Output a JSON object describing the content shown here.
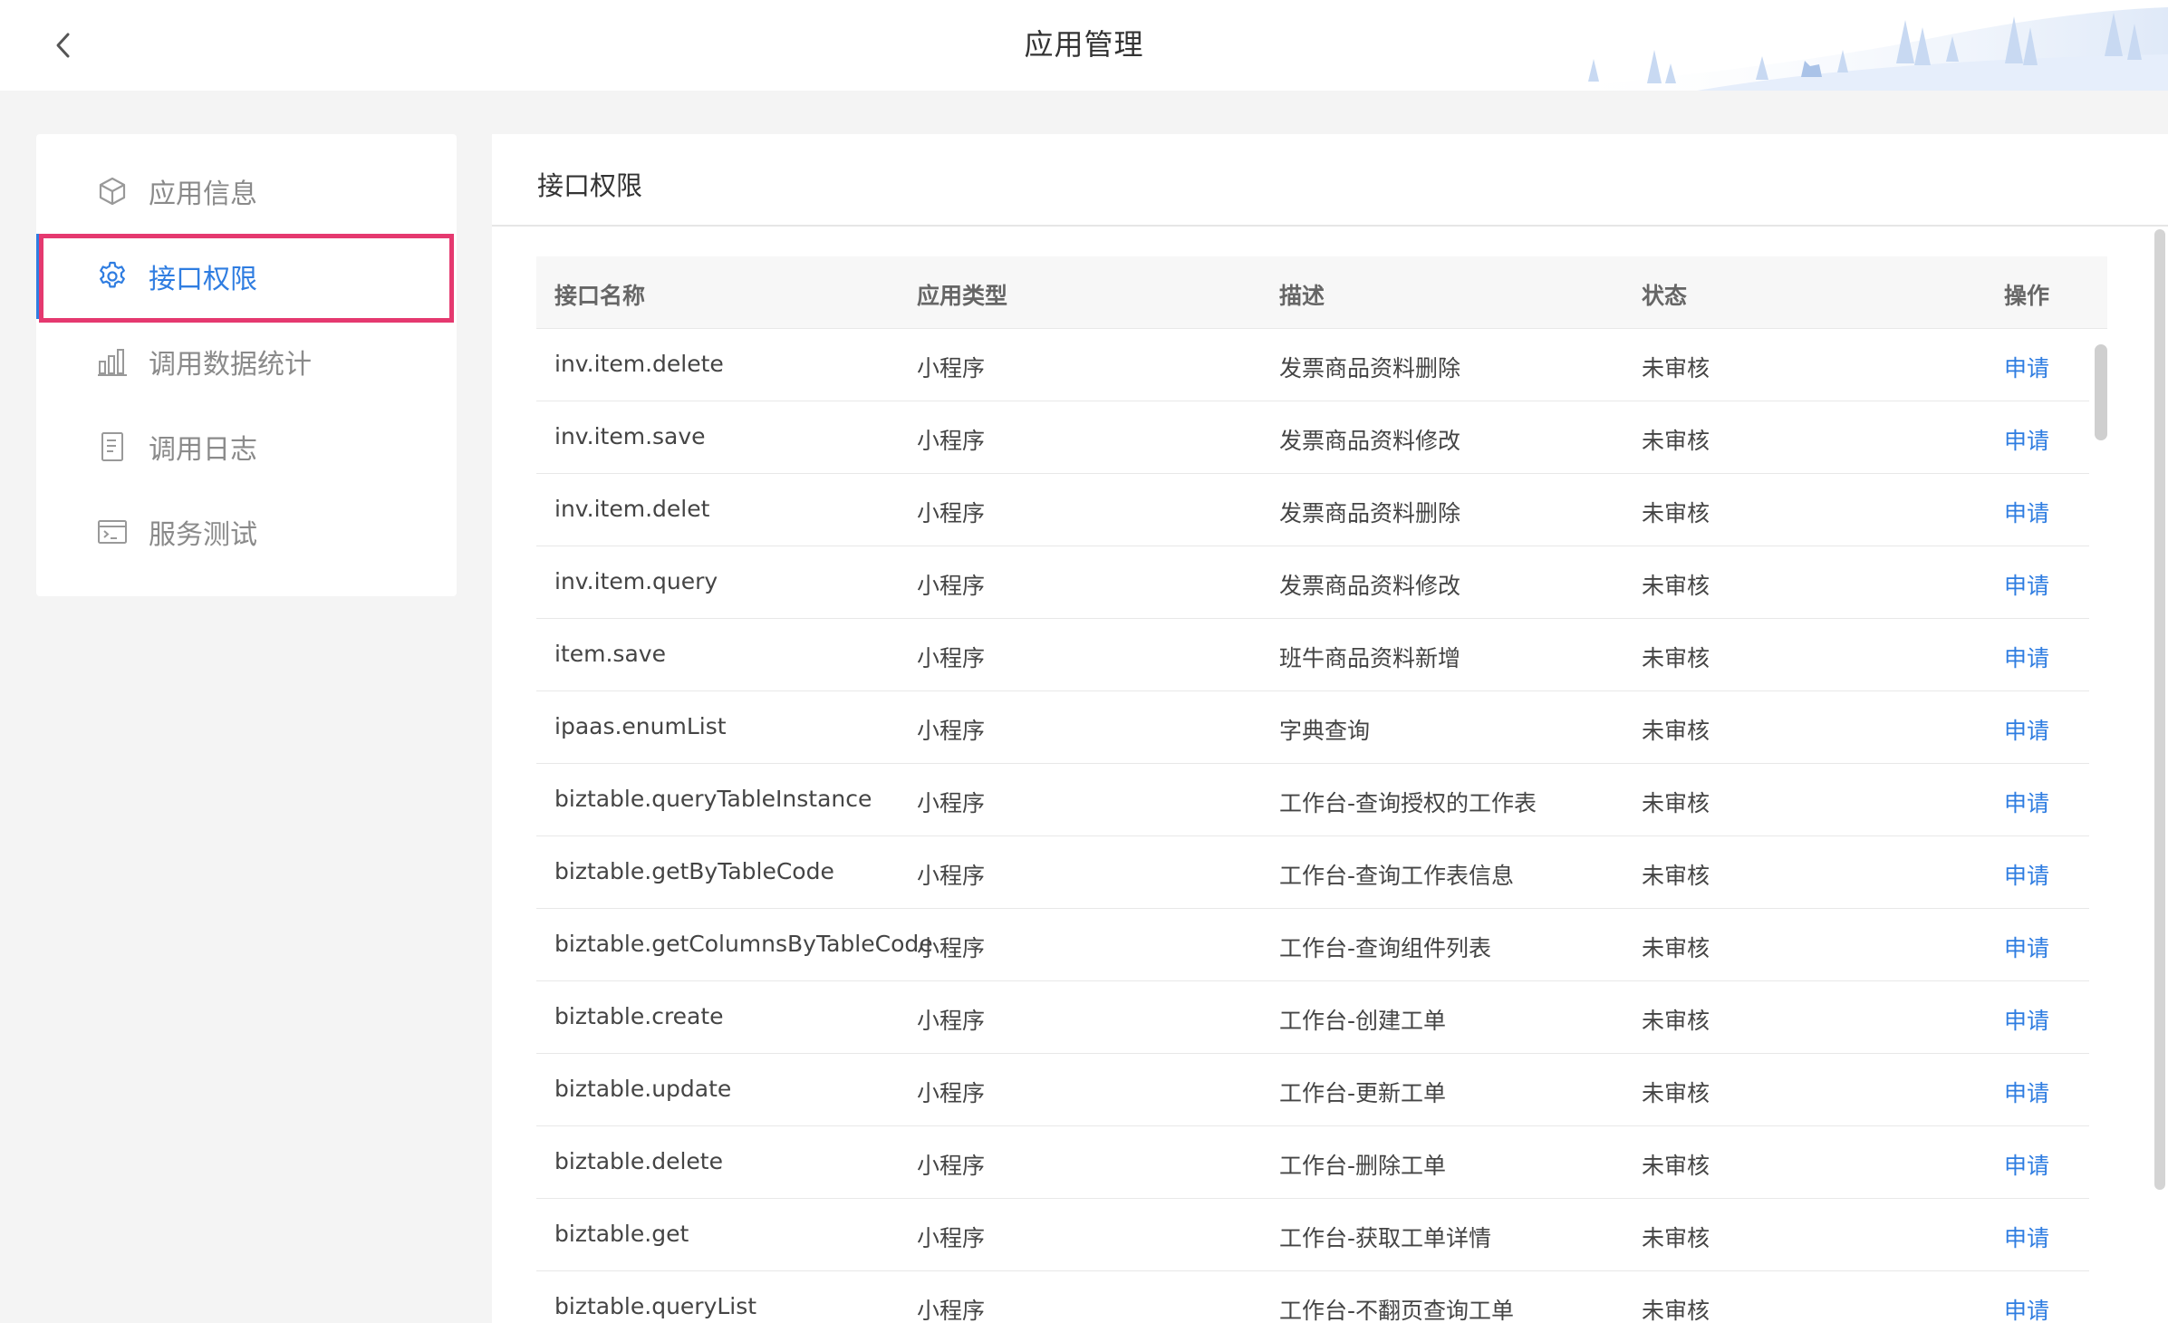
{
  "header": {
    "title": "应用管理",
    "back_icon": "chevron-left-icon"
  },
  "sidebar": {
    "items": [
      {
        "label": "应用信息",
        "icon": "cube-icon"
      },
      {
        "label": "接口权限",
        "icon": "gear-icon",
        "active": true
      },
      {
        "label": "调用数据统计",
        "icon": "bar-chart-icon"
      },
      {
        "label": "调用日志",
        "icon": "document-icon"
      },
      {
        "label": "服务测试",
        "icon": "terminal-icon"
      }
    ]
  },
  "main": {
    "title": "接口权限",
    "table": {
      "columns": [
        "接口名称",
        "应用类型",
        "描述",
        "状态",
        "操作"
      ],
      "rows": [
        {
          "name": "inv.item.delete",
          "type": "小程序",
          "desc": "发票商品资料删除",
          "status": "未审核",
          "action": "申请"
        },
        {
          "name": "inv.item.save",
          "type": "小程序",
          "desc": "发票商品资料修改",
          "status": "未审核",
          "action": "申请"
        },
        {
          "name": "inv.item.delet",
          "type": "小程序",
          "desc": "发票商品资料删除",
          "status": "未审核",
          "action": "申请"
        },
        {
          "name": "inv.item.query",
          "type": "小程序",
          "desc": "发票商品资料修改",
          "status": "未审核",
          "action": "申请"
        },
        {
          "name": "item.save",
          "type": "小程序",
          "desc": "班牛商品资料新增",
          "status": "未审核",
          "action": "申请"
        },
        {
          "name": "ipaas.enumList",
          "type": "小程序",
          "desc": "字典查询",
          "status": "未审核",
          "action": "申请"
        },
        {
          "name": "biztable.queryTableInstance",
          "type": "小程序",
          "desc": "工作台-查询授权的工作表",
          "status": "未审核",
          "action": "申请"
        },
        {
          "name": "biztable.getByTableCode",
          "type": "小程序",
          "desc": "工作台-查询工作表信息",
          "status": "未审核",
          "action": "申请"
        },
        {
          "name": "biztable.getColumnsByTableCode",
          "type": "小程序",
          "desc": "工作台-查询组件列表",
          "status": "未审核",
          "action": "申请"
        },
        {
          "name": "biztable.create",
          "type": "小程序",
          "desc": "工作台-创建工单",
          "status": "未审核",
          "action": "申请"
        },
        {
          "name": "biztable.update",
          "type": "小程序",
          "desc": "工作台-更新工单",
          "status": "未审核",
          "action": "申请"
        },
        {
          "name": "biztable.delete",
          "type": "小程序",
          "desc": "工作台-删除工单",
          "status": "未审核",
          "action": "申请"
        },
        {
          "name": "biztable.get",
          "type": "小程序",
          "desc": "工作台-获取工单详情",
          "status": "未审核",
          "action": "申请"
        },
        {
          "name": "biztable.queryList",
          "type": "小程序",
          "desc": "工作台-不翻页查询工单",
          "status": "未审核",
          "action": "申请"
        }
      ]
    }
  },
  "colors": {
    "accent": "#2f7de1",
    "highlight_outline": "#e5396f",
    "background": "#f4f4f4"
  }
}
